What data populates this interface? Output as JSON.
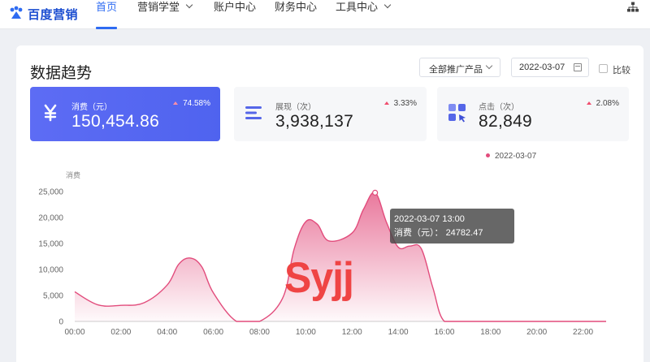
{
  "brand": {
    "name": "百度营销"
  },
  "nav": [
    {
      "label": "首页",
      "active": true,
      "dropdown": false
    },
    {
      "label": "营销学堂",
      "active": false,
      "dropdown": true
    },
    {
      "label": "账户中心",
      "active": false,
      "dropdown": false
    },
    {
      "label": "财务中心",
      "active": false,
      "dropdown": false
    },
    {
      "label": "工具中心",
      "active": false,
      "dropdown": true
    }
  ],
  "panel": {
    "title": "数据趋势",
    "product_select": "全部推广产品",
    "date": "2022-03-07",
    "compare_label": "比较"
  },
  "metrics": [
    {
      "label": "消费（元）",
      "value": "150,454.86",
      "change": "74.58%",
      "icon": "yen-icon"
    },
    {
      "label": "展现（次）",
      "value": "3,938,137",
      "change": "3.33%",
      "icon": "bars-icon"
    },
    {
      "label": "点击（次）",
      "value": "82,849",
      "change": "2.08%",
      "icon": "grid-click-icon"
    }
  ],
  "colors": {
    "accent": "#2e6bf2",
    "series": "#e24c7c",
    "metric_active": "#5568f0",
    "watermark": "#ef4444"
  },
  "tooltip": {
    "time": "2022-03-07 13:00",
    "label": "消费（元）：",
    "value": "24782.47"
  },
  "watermark": "Syjj",
  "chart_data": {
    "type": "area",
    "ylabel": "消费",
    "ylim": [
      0,
      25000
    ],
    "yticks": [
      "25,000",
      "20,000",
      "15,000",
      "10,000",
      "5,000",
      "0"
    ],
    "ytick_values": [
      25000,
      20000,
      15000,
      10000,
      5000,
      0
    ],
    "xticks": [
      "00:00",
      "02:00",
      "04:00",
      "06:00",
      "08:00",
      "10:00",
      "12:00",
      "14:00",
      "16:00",
      "18:00",
      "20:00",
      "22:00"
    ],
    "x": [
      0,
      1,
      2,
      3,
      4,
      4.5,
      5,
      5.5,
      6,
      7,
      8,
      9,
      9.5,
      10,
      10.5,
      11,
      12,
      12.5,
      13,
      13.5,
      14,
      14.5,
      15,
      15.5,
      16,
      17,
      18,
      19,
      20,
      21,
      22,
      23
    ],
    "series": [
      {
        "name": "2022-03-07",
        "values": [
          5700,
          3200,
          3100,
          3600,
          7000,
          11000,
          12200,
          10500,
          5500,
          0,
          0,
          4500,
          14000,
          19200,
          18700,
          15500,
          17000,
          21600,
          24782,
          19000,
          14300,
          14500,
          14000,
          6500,
          0,
          0,
          0,
          0,
          0,
          0,
          0,
          0
        ]
      }
    ]
  }
}
